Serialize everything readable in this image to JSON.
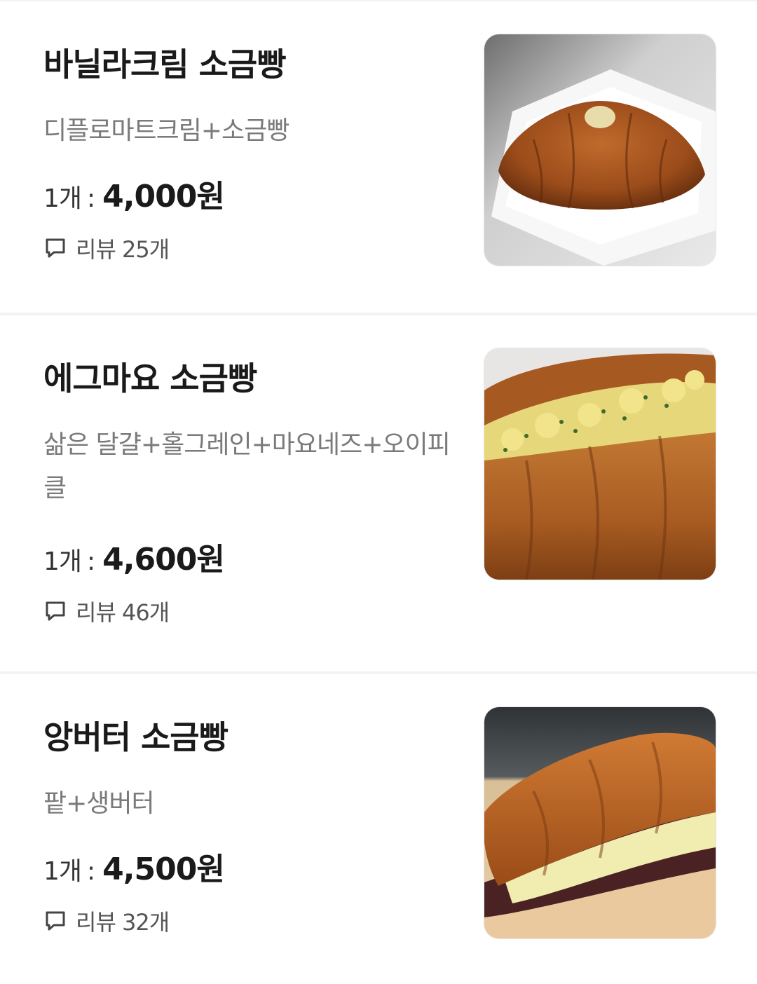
{
  "menu": {
    "items": [
      {
        "name": "바닐라크림 소금빵",
        "description": "디플로마트크림+소금빵",
        "quantity_label": "1개",
        "price": "4,000원",
        "review_label": "리뷰 25개",
        "image": "vanilla-cream-salt-bread-photo"
      },
      {
        "name": "에그마요 소금빵",
        "description": "삶은 달걀+홀그레인+마요네즈+오이피클",
        "quantity_label": "1개",
        "price": "4,600원",
        "review_label": "리뷰 46개",
        "image": "egg-mayo-salt-bread-photo"
      },
      {
        "name": "앙버터 소금빵",
        "description": "팥+생버터",
        "quantity_label": "1개",
        "price": "4,500원",
        "review_label": "리뷰 32개",
        "image": "red-bean-butter-salt-bread-photo"
      }
    ]
  },
  "icons": {
    "review": "speech-bubble-icon"
  }
}
